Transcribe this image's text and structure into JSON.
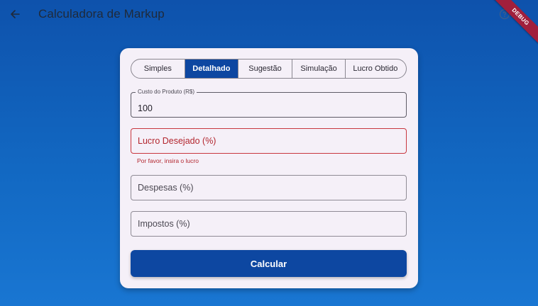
{
  "appbar": {
    "title": "Calculadora de Markup",
    "back_icon": "arrow-left-icon",
    "help_icon": "help-circle-icon"
  },
  "debug_banner": {
    "label": "DEBUG"
  },
  "tabs": [
    {
      "label": "Simples",
      "active": false
    },
    {
      "label": "Detalhado",
      "active": true
    },
    {
      "label": "Sugestão",
      "active": false
    },
    {
      "label": "Simulação",
      "active": false
    },
    {
      "label": "Lucro Obtido",
      "active": false
    }
  ],
  "form": {
    "custo": {
      "label": "Custo do Produto (R$)",
      "value": "100"
    },
    "lucro": {
      "label": "Lucro Desejado (%)",
      "value": "",
      "error": "Por favor, insira o lucro"
    },
    "despesas": {
      "label": "Despesas (%)",
      "value": ""
    },
    "impostos": {
      "label": "Impostos (%)",
      "value": ""
    }
  },
  "button": {
    "label": "Calcular"
  },
  "colors": {
    "primary": "#0d47a1",
    "error": "#b3262e",
    "card_bg": "#f5f0f8",
    "bg_top": "#0e52ac",
    "bg_bottom": "#1976d2"
  }
}
